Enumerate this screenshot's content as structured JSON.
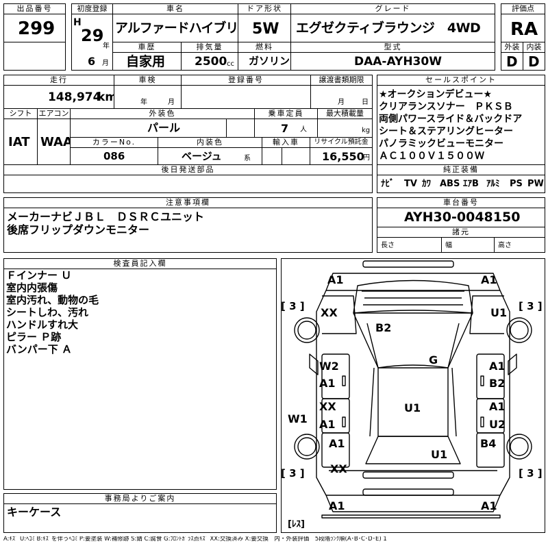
{
  "top": {
    "lot_label": "出品番号",
    "lot": "299",
    "reg_label": "初度登録",
    "era": "H",
    "year": "29",
    "year_unit": "年",
    "month": "6",
    "month_unit": "月",
    "name_label": "車名",
    "name": "アルファードハイブリッド",
    "door_label": "ドア形状",
    "door": "5W",
    "grade_label": "グレード",
    "grade": "エグゼクティブラウンジ　4WD",
    "score_label": "評価点",
    "score": "RA",
    "history_label": "車歴",
    "history": "自家用",
    "displacement_label": "排気量",
    "displacement": "2500",
    "displacement_unit": "cc",
    "fuel_label": "燃料",
    "fuel": "ガソリン",
    "model_label": "型式",
    "model": "DAA-AYH30W",
    "ext_label": "外装",
    "ext": "D",
    "int_label": "内装",
    "int": "D"
  },
  "row2": {
    "mileage_label": "走行",
    "mileage": "148,974",
    "mileage_unit": "km",
    "inspection_label": "車検",
    "insp_year": "年",
    "insp_month": "月",
    "regno_label": "登録番号",
    "transfer_label": "譲渡書類期限",
    "tr_month": "月",
    "tr_day": "日",
    "shift_label": "シフト",
    "shift": "IAT",
    "ac_label": "エアコン",
    "ac": "WAA",
    "extcolor_label": "外装色",
    "extcolor": "パール",
    "capacity_label": "乗車定員",
    "capacity": "7",
    "capacity_unit": "人",
    "load_label": "最大積載量",
    "load_unit": "kg",
    "colorno_label": "カラーNo.",
    "colorno": "086",
    "intcolor_label": "内装色",
    "intcolor": "ベージュ",
    "intcolor_unit": "系",
    "import_label": "輸入車",
    "recycle_label": "リサイクル預託金",
    "recycle": "16,550",
    "recycle_unit": "円",
    "later_label": "後日発送部品"
  },
  "sales": {
    "label": "セールスポイント",
    "lines": [
      "★オークションデビュー★",
      "クリアランスソナー　ＰＫＳＢ",
      "両側パワースライド＆バックドア",
      "シート＆ステアリングヒーター",
      "パノラミックビューモニター",
      "ＡＣ１００Ｖ１５００Ｗ"
    ]
  },
  "equipment": {
    "label": "純正装備",
    "items": [
      "ﾅﾋﾞ",
      "TV",
      "ｶﾜ",
      "ABS",
      "ｴｱB",
      "ｱﾙﾐ",
      "PS",
      "PW"
    ]
  },
  "notes": {
    "label": "注意事項欄",
    "lines": [
      "メーカーナビＪＢＬ　ＤＳＲＣユニット",
      "後席フリップダウンモニター"
    ]
  },
  "chassis": {
    "label": "車台番号",
    "value": "AYH30-0048150"
  },
  "dims": {
    "label": "諸元",
    "length": "長さ",
    "width": "幅",
    "height": "高さ"
  },
  "inspector": {
    "label": "検査員記入欄",
    "lines": [
      "Ｆインナー Ｕ",
      "室内内張傷",
      "室内汚れ、動物の毛",
      "シートしわ、汚れ",
      "ハンドルすれ大",
      "ピラー Ｐ跡",
      "バンパー下 Ａ"
    ]
  },
  "office": {
    "label": "事務局よりご案内",
    "text": "キーケース"
  },
  "diagram": {
    "marks": {
      "fl_bumper": "A1",
      "fr_bumper": "A1",
      "fl_fender": "XX",
      "fr_fender": "U1",
      "hood": "B2",
      "windshield": "G",
      "l_front_door": "W2",
      "l_front_door2": "A1",
      "r_front_door": "A1",
      "r_front_door2": "B2",
      "l_rear_door": "XX",
      "l_rear_door2": "A1",
      "r_rear_door": "A1",
      "r_rear_door2": "U2",
      "l_sill": "W1",
      "roof": "U1",
      "l_quarter": "A1",
      "r_quarter": "B4",
      "rear_glass": "U1",
      "rear_left": "XX",
      "rl_bumper": "A1",
      "rr_bumper": "A1",
      "tire_fl": "[ 3 ]",
      "tire_fr": "[ 3 ]",
      "tire_rl": "[ 3 ]",
      "tire_rr": "[ 3 ]",
      "spare": "[ﾚｽ]"
    }
  },
  "legend": "A:ｷｽﾞ U:ﾍｺﾐ B:ｷｽﾞを伴うﾍｺﾐ P:要塗装 W:補修跡 S:錆 C:腐食 G:ﾌﾛﾝﾄｶﾞﾗｽ点ｷｽﾞ XX:交換済み X:要交換　内・外装評価　5段階ﾗﾝｸ順(A･B･C･D･E) 1"
}
